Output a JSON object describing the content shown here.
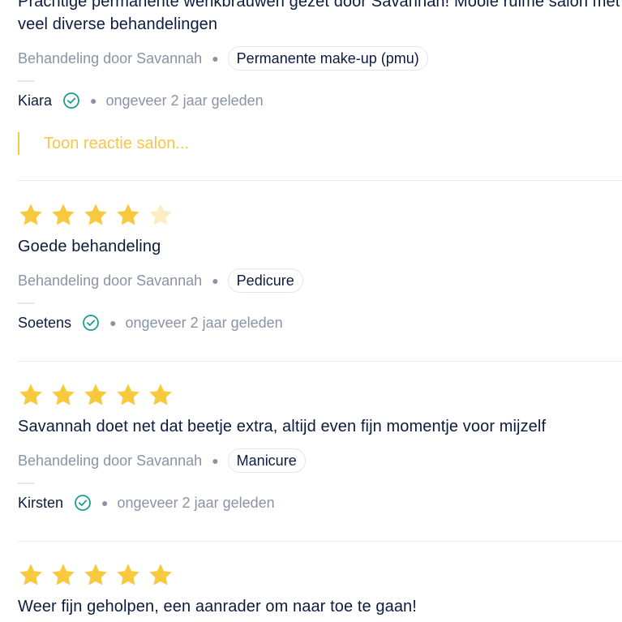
{
  "reviews": [
    {
      "text": "Prachtige permanente wenkbrauwen gezet door Savannah! Mooie ruime salon met veel diverse behandelingen",
      "treatment_by": "Behandeling door Savannah",
      "treatment": "Permanente make-up (pmu)",
      "author": "Kiara",
      "time": "ongeveer 2 jaar geleden",
      "show_reaction": "Toon reactie salon..."
    },
    {
      "rating": 4,
      "text": "Goede behandeling",
      "treatment_by": "Behandeling door Savannah",
      "treatment": "Pedicure",
      "author": "Soetens",
      "time": "ongeveer 2 jaar geleden"
    },
    {
      "rating": 5,
      "text": "Savannah doet net dat beetje extra, altijd even fijn momentje voor mijzelf",
      "treatment_by": "Behandeling door Savannah",
      "treatment": "Manicure",
      "author": "Kirsten",
      "time": "ongeveer 2 jaar geleden"
    },
    {
      "rating": 5,
      "text": "Weer fijn geholpen, een aanrader om naar toe te gaan!"
    }
  ],
  "colors": {
    "star": "#f8c93d",
    "star_empty": "#fcedc0",
    "verified": "#1a9e8f",
    "link": "#f6c54a"
  }
}
